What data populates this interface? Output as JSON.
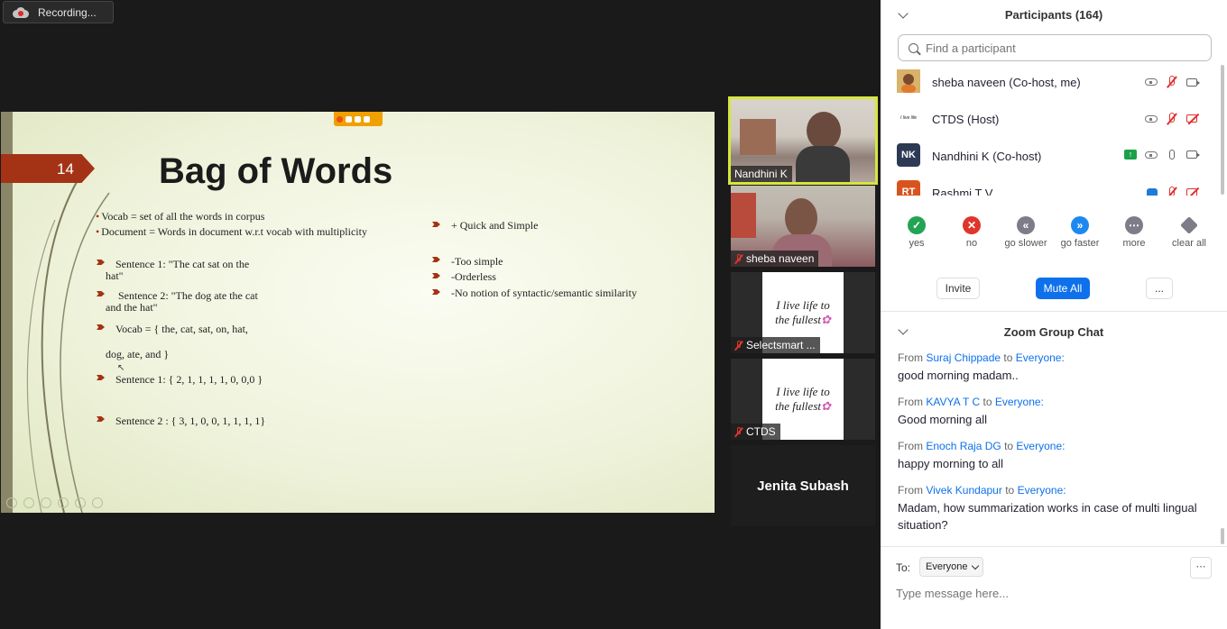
{
  "recording": {
    "label": "Recording..."
  },
  "slide": {
    "number": "14",
    "title": "Bag of Words",
    "left_bullets": [
      "Vocab = set of all the words in corpus",
      "Document = Words in document w.r.t vocab with multiplicity"
    ],
    "left_points": {
      "s1_line1": "Sentence 1: \"The cat sat on the",
      "s1_line2": "hat\"",
      "s2_line1": "Sentence 2: \"The dog ate the cat",
      "s2_line2": "and the hat\"",
      "vocab_line1": "Vocab = { the, cat, sat, on, hat,",
      "vocab_line2": "dog, ate, and }",
      "vec1": "Sentence 1: { 2, 1, 1, 1, 1, 0, 0,0 }",
      "vec2": "Sentence 2 : { 3, 1, 0, 0, 1, 1, 1, 1}"
    },
    "right_points": [
      "+ Quick and Simple",
      "-Too simple",
      "-Orderless",
      "-No notion of syntactic/semantic similarity"
    ]
  },
  "video_tiles": [
    {
      "name": "Nandhini K"
    },
    {
      "name": "sheba naveen"
    },
    {
      "name": "Selectsmart ...",
      "card_line1": "I live life to",
      "card_line2": "the fullest"
    },
    {
      "name": "CTDS",
      "card_line1": "I live life to",
      "card_line2": "the fullest"
    },
    {
      "name": "Jenita Subash"
    }
  ],
  "participants": {
    "title": "Participants (164)",
    "search_placeholder": "Find a participant",
    "list": [
      {
        "name": "sheba naveen (Co-host, me)",
        "initials": ""
      },
      {
        "name": "CTDS (Host)",
        "initials": ""
      },
      {
        "name": "Nandhini K (Co-host)",
        "initials": "NK"
      },
      {
        "name": "Rashmi T V",
        "initials": "RT"
      }
    ],
    "reactions": [
      {
        "label": "yes",
        "color": "#23a455"
      },
      {
        "label": "no",
        "color": "#e0352b"
      },
      {
        "label": "go slower",
        "color": "#7d7d8a"
      },
      {
        "label": "go faster",
        "color": "#1e88f0"
      },
      {
        "label": "more",
        "color": "#7d7d8a"
      },
      {
        "label": "clear all",
        "color": "#7d7d8a"
      }
    ],
    "invite_label": "Invite",
    "mute_all_label": "Mute All",
    "more_label": "..."
  },
  "chat": {
    "title": "Zoom Group Chat",
    "from_word": "From",
    "to_word": "to",
    "messages": [
      {
        "from": "Suraj Chippade",
        "to": "Everyone:",
        "text": "good morning madam.."
      },
      {
        "from": "KAVYA T C",
        "to": "Everyone:",
        "text": "Good morning all"
      },
      {
        "from": "Enoch Raja DG",
        "to": "Everyone:",
        "text": "happy morning to all"
      },
      {
        "from": "Vivek Kundapur",
        "to": "Everyone:",
        "text": "Madam, how summarization works in case of multi lingual situation?"
      }
    ],
    "to_label": "To:",
    "to_value": "Everyone",
    "more_label": "⋯",
    "input_placeholder": "Type message here..."
  },
  "colors": {
    "accent": "#0e71eb",
    "slide_accent": "#a43315",
    "active_speaker": "#d7e63c"
  }
}
